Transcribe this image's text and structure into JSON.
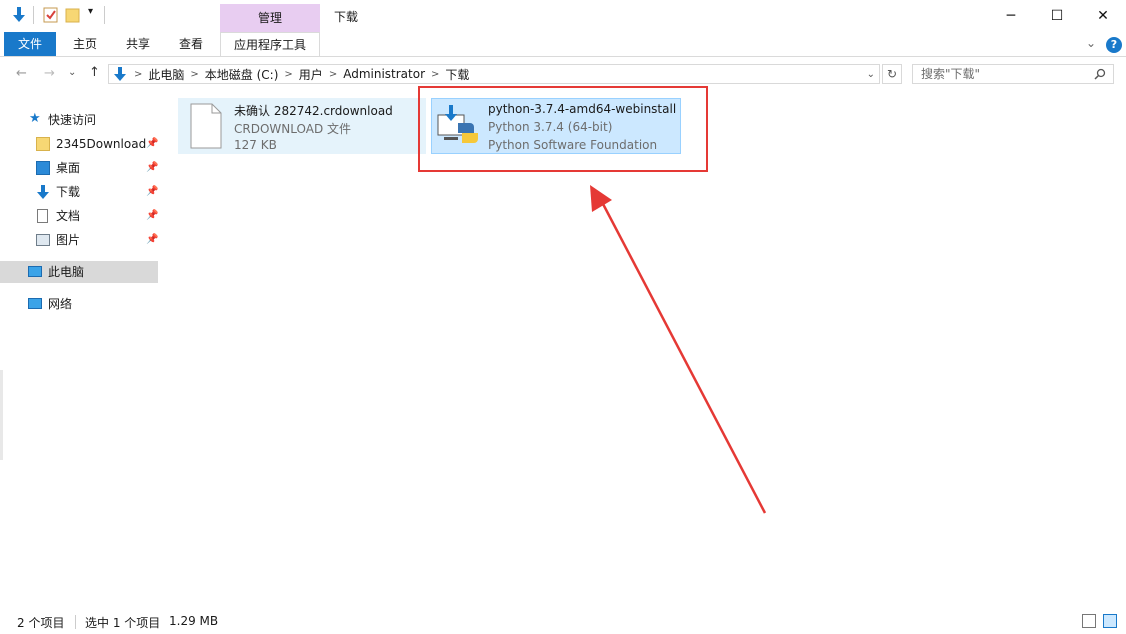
{
  "titlebar": {
    "manage_tab": "管理",
    "window_title": "下载",
    "minimize": "─",
    "maximize": "☐",
    "close": "✕"
  },
  "ribbon": {
    "tabs": [
      "文件",
      "主页",
      "共享",
      "查看",
      "应用程序工具"
    ],
    "collapse": "⌄",
    "help": "?"
  },
  "address": {
    "crumbs": [
      "此电脑",
      "本地磁盘 (C:)",
      "用户",
      "Administrator",
      "下载"
    ],
    "search_placeholder": "搜索\"下载\""
  },
  "nav": {
    "quick_access": "快速访问",
    "items": [
      {
        "label": "2345Download"
      },
      {
        "label": "桌面"
      },
      {
        "label": "下载"
      },
      {
        "label": "文档"
      },
      {
        "label": "图片"
      }
    ],
    "this_pc": "此电脑",
    "network": "网络"
  },
  "files": [
    {
      "name": "未确认 282742.crdownload",
      "type": "CRDOWNLOAD 文件",
      "size": "127 KB"
    },
    {
      "name": "python-3.7.4-amd64-webinstall",
      "type": "Python 3.7.4 (64-bit)",
      "publisher": "Python Software Foundation"
    }
  ],
  "status": {
    "count": "2 个项目",
    "selected": "选中 1 个项目",
    "size": "1.29 MB"
  },
  "colors": {
    "accent": "#1979ca",
    "manage": "#e8cdf1",
    "selection": "#cce8ff",
    "annotation": "#e53935"
  }
}
